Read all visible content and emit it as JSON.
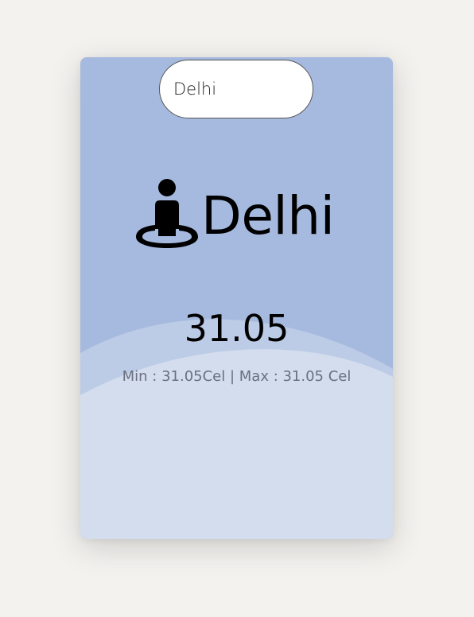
{
  "search": {
    "value": "Delhi",
    "placeholder": ""
  },
  "location": {
    "icon": "person-location-icon",
    "city": "Delhi"
  },
  "weather": {
    "temperature": "31.05",
    "min_max": "Min : 31.05Cel | Max : 31.05 Cel"
  },
  "colors": {
    "page_background": "#f3f2ef",
    "card_top": "#a6badf",
    "wave_middle": "#bccbe6",
    "wave_bottom": "#d3dded"
  }
}
